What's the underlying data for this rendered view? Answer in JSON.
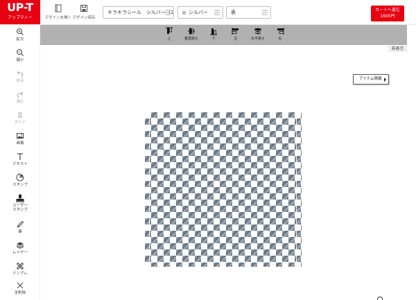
{
  "header": {
    "logo_main": "UP-T",
    "logo_sub": "アップティー",
    "open_design_label": "デザインを開く",
    "save_design_label": "デザイン保存",
    "product_select": "キラキラシール　シルバー（1",
    "color_select": "シルバー",
    "side_select": "表",
    "cart_line1": "カートへ進む",
    "cart_line2": "1600円",
    "cart_color": "#e60012"
  },
  "sidebar": {
    "items": [
      {
        "label": "拡大",
        "icon": "zoom-in-icon"
      },
      {
        "label": "縮小",
        "icon": "zoom-out-icon"
      },
      {
        "label": "戻る",
        "icon": "undo-icon"
      },
      {
        "label": "進む",
        "icon": "redo-icon"
      },
      {
        "label": "ガイド",
        "icon": "guide-icon"
      },
      {
        "label": "画像",
        "icon": "image-icon"
      },
      {
        "label": "テキスト",
        "icon": "text-icon"
      },
      {
        "label": "スタンプ",
        "icon": "stamp-icon"
      },
      {
        "label": "ユーザー\nスタンプ",
        "icon": "user-stamp-icon"
      },
      {
        "label": "筆",
        "icon": "brush-icon"
      },
      {
        "label": "レイヤー",
        "icon": "layers-icon"
      },
      {
        "label": "テンプレ",
        "icon": "template-icon"
      },
      {
        "label": "全削除",
        "icon": "delete-all-icon"
      }
    ]
  },
  "alignbar": {
    "items": [
      {
        "label": "上",
        "icon": "align-top-icon"
      },
      {
        "label": "垂直揃え",
        "icon": "align-vertical-center-icon"
      },
      {
        "label": "下",
        "icon": "align-bottom-icon"
      },
      {
        "label": "左",
        "icon": "align-left-icon"
      },
      {
        "label": "水平揃え",
        "icon": "align-horizontal-center-icon"
      },
      {
        "label": "右",
        "icon": "align-right-icon"
      }
    ]
  },
  "canvas": {
    "hide_label": "非表示",
    "item_info_label": "アイテム情報"
  }
}
